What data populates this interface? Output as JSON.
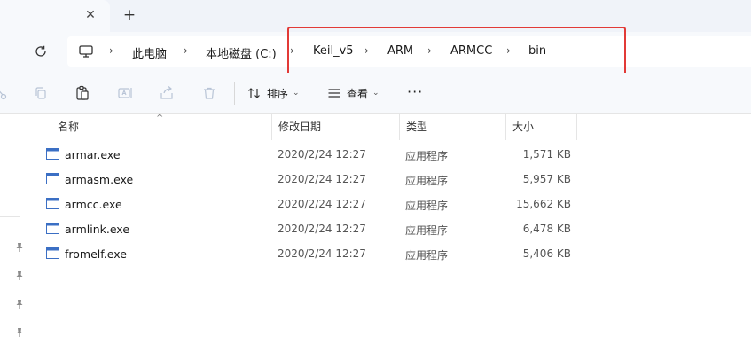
{
  "breadcrumb": [
    {
      "label": "此电脑"
    },
    {
      "label": "本地磁盘 (C:)"
    },
    {
      "label": "Keil_v5"
    },
    {
      "label": "ARM"
    },
    {
      "label": "ARMCC"
    },
    {
      "label": "bin"
    }
  ],
  "toolbar": {
    "sort_label": "排序",
    "view_label": "查看",
    "more_label": "···"
  },
  "columns": {
    "name": "名称",
    "date": "修改日期",
    "type": "类型",
    "size": "大小"
  },
  "files": [
    {
      "name": "armar.exe",
      "date": "2020/2/24 12:27",
      "type": "应用程序",
      "size": "1,571 KB"
    },
    {
      "name": "armasm.exe",
      "date": "2020/2/24 12:27",
      "type": "应用程序",
      "size": "5,957 KB"
    },
    {
      "name": "armcc.exe",
      "date": "2020/2/24 12:27",
      "type": "应用程序",
      "size": "15,662 KB"
    },
    {
      "name": "armlink.exe",
      "date": "2020/2/24 12:27",
      "type": "应用程序",
      "size": "6,478 KB"
    },
    {
      "name": "fromelf.exe",
      "date": "2020/2/24 12:27",
      "type": "应用程序",
      "size": "5,406 KB"
    }
  ],
  "colors": {
    "highlight": "#e23a37",
    "chrome": "#f7f9fc",
    "file_icon": "#3b6fc4"
  }
}
